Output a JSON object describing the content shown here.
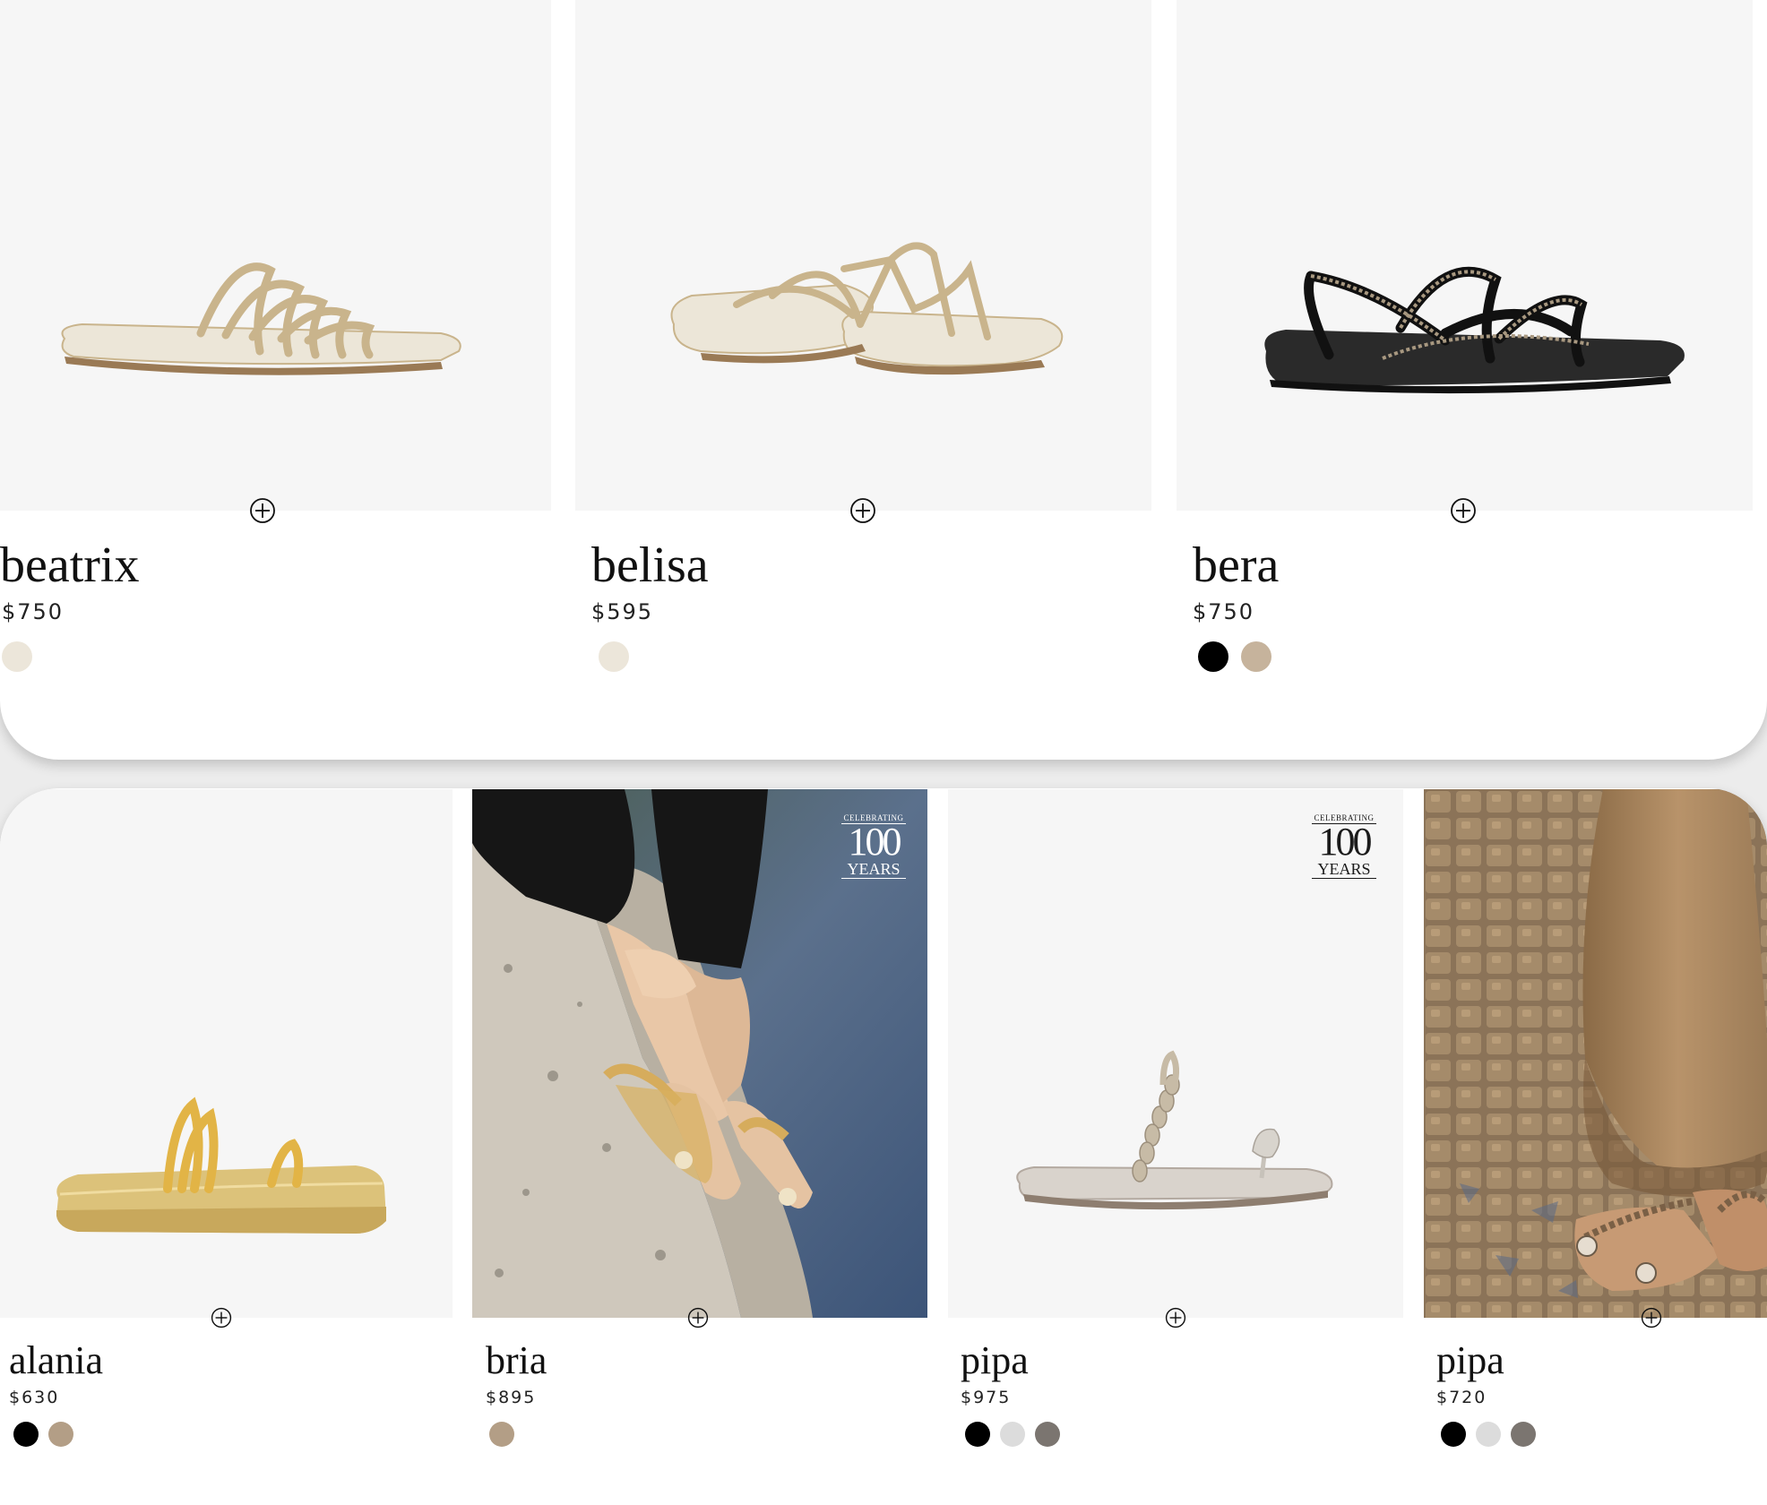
{
  "colors": {
    "gold": "#c9b48c",
    "cream": "#ece6da",
    "black": "#000000",
    "taupe": "#c6b39c",
    "tan": "#b39e86",
    "light_gray": "#dcdcdc",
    "gray": "#7b7570",
    "background": "#f6f6f6"
  },
  "add_icon": "circle-plus-icon",
  "top_row": [
    {
      "name": "beatrix",
      "price": "$750",
      "swatches": [
        "#ece6da"
      ]
    },
    {
      "name": "belisa",
      "price": "$595",
      "swatches": [
        "#ece6da"
      ]
    },
    {
      "name": "bera",
      "price": "$750",
      "swatches": [
        "#000000",
        "#c6b39c"
      ]
    }
  ],
  "bottom_row": [
    {
      "name": "alania",
      "price": "$630",
      "swatches": [
        "#000000",
        "#b39e86"
      ]
    },
    {
      "name": "bria",
      "price": "$895",
      "swatches": [
        "#b39e86"
      ]
    },
    {
      "name": "pipa",
      "price": "$975",
      "swatches": [
        "#000000",
        "#dcdcdc",
        "#7b7570"
      ]
    },
    {
      "name": "pipa",
      "price": "$720",
      "swatches": [
        "#000000",
        "#dcdcdc",
        "#7b7570"
      ]
    }
  ],
  "badge": {
    "top": "CELEBRATING",
    "number": "100",
    "bottom": "YEARS"
  }
}
